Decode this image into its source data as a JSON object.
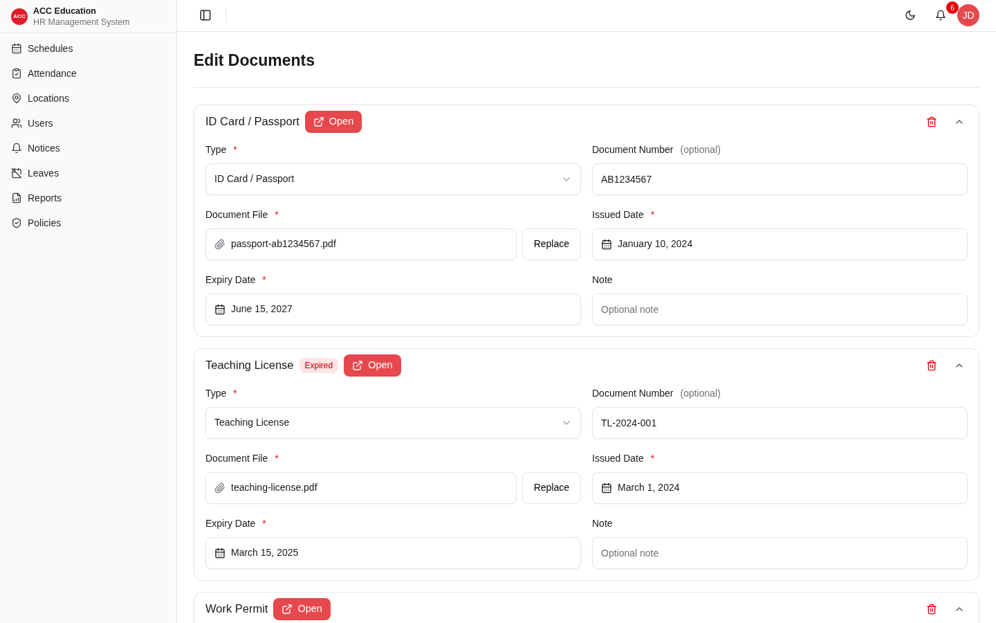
{
  "brand": {
    "logo": "ACC",
    "name": "ACC Education",
    "subtitle": "HR Management System"
  },
  "sidebar": {
    "items": [
      {
        "label": "Schedules"
      },
      {
        "label": "Attendance"
      },
      {
        "label": "Locations"
      },
      {
        "label": "Users"
      },
      {
        "label": "Notices"
      },
      {
        "label": "Leaves"
      },
      {
        "label": "Reports"
      },
      {
        "label": "Policies"
      }
    ]
  },
  "topbar": {
    "notification_count": "6",
    "avatar": "JD"
  },
  "page": {
    "title": "Edit Documents"
  },
  "documents": [
    {
      "title": "ID Card / Passport",
      "open_label": "Open",
      "expanded": true,
      "fields": [
        {
          "kind": "select",
          "label": "Type",
          "required_mark": "*",
          "value": "ID Card / Passport"
        },
        {
          "kind": "text",
          "label": "Document Number",
          "hint": "(optional)",
          "value": "AB1234567"
        },
        {
          "kind": "file",
          "label": "Document File",
          "required_mark": "*",
          "value": "passport-ab1234567.pdf",
          "button": "Replace"
        },
        {
          "kind": "date",
          "label": "Issued Date",
          "required_mark": "*",
          "value": "January 10, 2024"
        },
        {
          "kind": "date",
          "label": "Expiry Date",
          "required_mark": "*",
          "value": "June 15, 2027"
        },
        {
          "kind": "text",
          "label": "Note",
          "placeholder": "Optional note"
        }
      ]
    },
    {
      "title": "Teaching License",
      "badge": "Expired",
      "open_label": "Open",
      "expanded": true,
      "fields": [
        {
          "kind": "select",
          "label": "Type",
          "required_mark": "*",
          "value": "Teaching License"
        },
        {
          "kind": "text",
          "label": "Document Number",
          "hint": "(optional)",
          "value": "TL-2024-001"
        },
        {
          "kind": "file",
          "label": "Document File",
          "required_mark": "*",
          "value": "teaching-license.pdf",
          "button": "Replace"
        },
        {
          "kind": "date",
          "label": "Issued Date",
          "required_mark": "*",
          "value": "March 1, 2024"
        },
        {
          "kind": "date",
          "label": "Expiry Date",
          "required_mark": "*",
          "value": "March 15, 2025"
        },
        {
          "kind": "text",
          "label": "Note",
          "placeholder": "Optional note"
        }
      ]
    },
    {
      "title": "Work Permit",
      "open_label": "Open",
      "expanded": true
    }
  ]
}
